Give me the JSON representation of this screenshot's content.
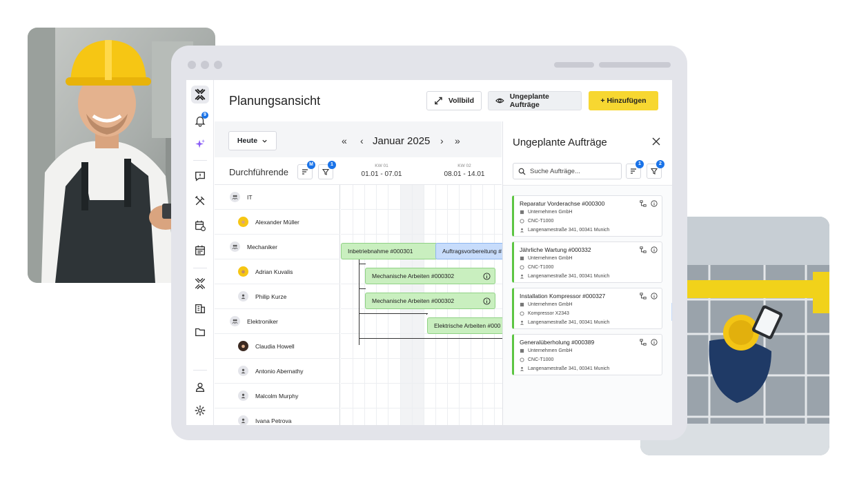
{
  "header": {
    "title": "Planungsansicht",
    "fullscreen_label": "Vollbild",
    "unplanned_label": "Ungeplante Aufträge",
    "add_label": "+ Hinzufügen",
    "accent_color": "#f7d731"
  },
  "sidebar": {
    "notification_count": "9",
    "items": [
      {
        "icon": "logo-icon"
      },
      {
        "icon": "bell-icon"
      },
      {
        "icon": "sparkle-icon"
      },
      {
        "icon": "message-alert-icon"
      },
      {
        "icon": "tools-icon"
      },
      {
        "icon": "calendar-clock-icon"
      },
      {
        "icon": "calendar-icon"
      },
      {
        "icon": "logo-mark-icon"
      },
      {
        "icon": "building-icon"
      },
      {
        "icon": "folder-icon"
      },
      {
        "icon": "user-icon"
      },
      {
        "icon": "gear-icon"
      }
    ]
  },
  "toolbar": {
    "today_label": "Heute",
    "month_label": "Januar 2025"
  },
  "grid": {
    "resources_label": "Durchführende",
    "sort_badge": "M",
    "filter_badge": "1",
    "weeks": [
      {
        "label": "KW 01",
        "range": "01.01 - 07.01"
      },
      {
        "label": "KW 02",
        "range": "08.01 - 14.01"
      }
    ]
  },
  "resources": [
    {
      "name": "IT",
      "type": "group"
    },
    {
      "name": "Alexander Müller",
      "type": "person"
    },
    {
      "name": "Mechaniker",
      "type": "group"
    },
    {
      "name": "Adrian Kuvalis",
      "type": "person"
    },
    {
      "name": "Philip Kurze",
      "type": "person"
    },
    {
      "name": "Elektroniker",
      "type": "group"
    },
    {
      "name": "Claudia Howell",
      "type": "person"
    },
    {
      "name": "Antonio Abernathy",
      "type": "person"
    },
    {
      "name": "Malcolm Murphy",
      "type": "person"
    },
    {
      "name": "Ivana Petrova",
      "type": "person"
    }
  ],
  "tasks": [
    {
      "label": "Inbetriebnahme #000301",
      "color": "green"
    },
    {
      "label": "Auftragsvorbereitung #",
      "color": "blue"
    },
    {
      "label": "Mechanische Arbeiten #000302",
      "color": "green"
    },
    {
      "label": "Mechanische Arbeiten #000302",
      "color": "green"
    },
    {
      "label": "Elektrische Arbeiten #000",
      "color": "green"
    }
  ],
  "panel": {
    "title": "Ungeplante Aufträge",
    "search_placeholder": "Suche Aufträge...",
    "sort_badge": "1",
    "filter_badge": "2",
    "cards": [
      {
        "title": "Reparatur Vorderachse #000300",
        "company": "Unternehmen GmbH",
        "asset": "CNC-T1000",
        "address": "Langenamestraße 341, 00341 Munich"
      },
      {
        "title": "Jährliche Wartung #000332",
        "company": "Unternehmen GmbH",
        "asset": "CNC-T1000",
        "address": "Langenamestraße 341, 00341 Munich"
      },
      {
        "title": "Installation Kompressor #000327",
        "company": "Unternehmen GmbH",
        "asset": "Kompressor X2343",
        "address": "Langenamestraße 341, 00341 Munich"
      },
      {
        "title": "Generalüberholung #000389",
        "company": "Unternehmen GmbH",
        "asset": "CNC-T1000",
        "address": "Langenamestraße 341, 00341 Munich"
      }
    ]
  }
}
